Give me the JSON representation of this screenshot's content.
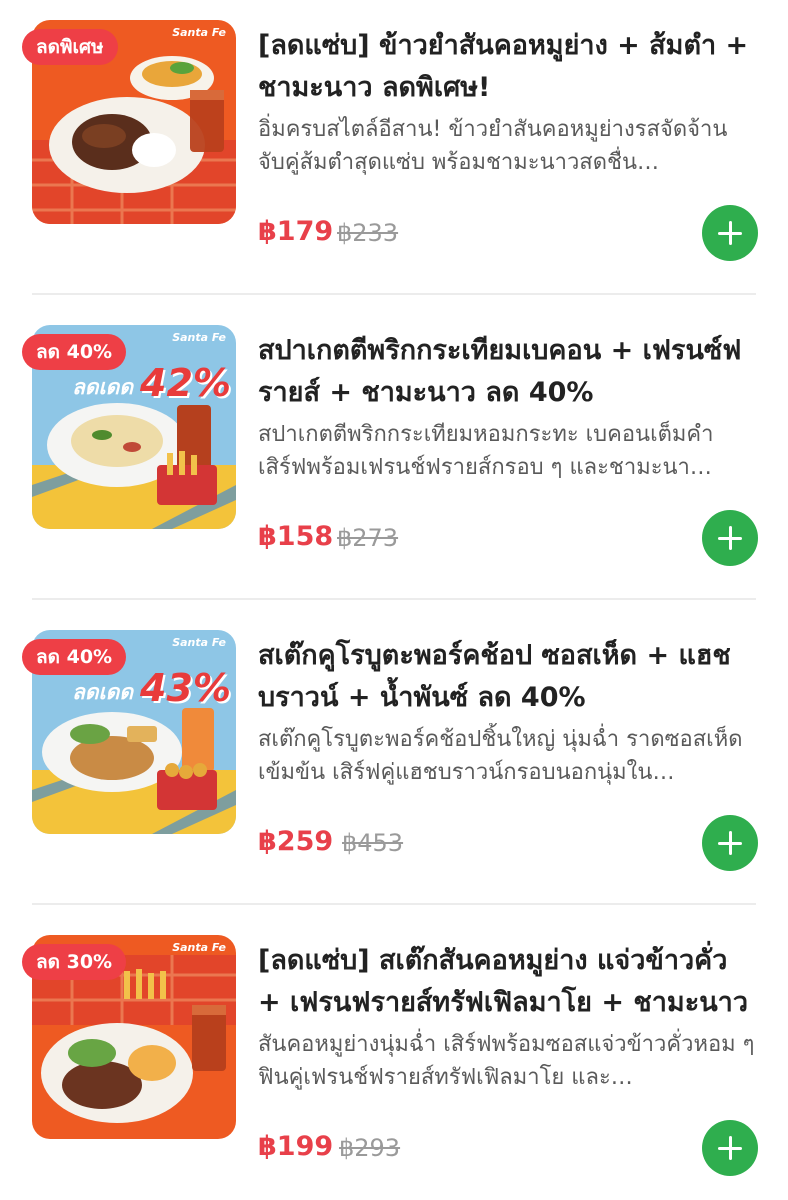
{
  "items": [
    {
      "badge": "ลดพิเศษ",
      "title": "[ลดแซ่บ] ข้าวยำสันคอหมูย่าง + ส้มตำ + ชามะนาว ลดพิเศษ!",
      "description": "อิ่มครบสไตล์อีสาน! ข้าวยำสันคอหมูย่างรสจัดจ้าน จับคู่ส้มตำสุดแซ่บ พร้อมชามะนาวสดชื่น…",
      "price": "฿179",
      "old_price": "฿233",
      "brand": "Santa Fe",
      "image": "pork-salad-rice-set"
    },
    {
      "badge": "ลด 40%",
      "title": "สปาเกตตีพริกกระเทียมเบคอน + เฟรนซ์ฟรายส์ + ชามะนาว ลด 40%",
      "description": "สปาเกตตีพริกกระเทียมหอมกระทะ เบคอนเต็มคำ เสิร์ฟพร้อมเฟรนช์ฟรายส์กรอบ ๆ และชามะนา…",
      "price": "฿158",
      "old_price": "฿273",
      "brand": "Santa Fe",
      "promo_text": "ลดเดด",
      "promo_percent": "42%",
      "image": "spaghetti-set"
    },
    {
      "badge": "ลด 40%",
      "title": "สเต๊กคูโรบูตะพอร์คช้อป ซอสเห็ด + แฮชบราวน์ + น้ำพันซ์ ลด 40%",
      "description": "สเต๊กคูโรบูตะพอร์คช้อปชิ้นใหญ่ นุ่มฉ่ำ ราดซอสเห็ดเข้มข้น เสิร์ฟคู่แฮชบราวน์กรอบนอกนุ่มใน…",
      "price": "฿259",
      "old_price": "฿453",
      "brand": "Santa Fe",
      "promo_text": "ลดเดด",
      "promo_percent": "43%",
      "image": "pork-chop-set"
    },
    {
      "badge": "ลด 30%",
      "title": "[ลดแซ่บ] สเต๊กสันคอหมูย่าง แจ่วข้าวคั่ว + เฟรนฟรายส์ทรัฟเฟิลมาโย + ชามะนาว",
      "description": "สันคอหมูย่างนุ่มฉ่ำ เสิร์ฟพร้อมซอสแจ่วข้าวคั่วหอม ๆ ฟินคู่เฟรนช์ฟรายส์ทรัฟเฟิลมาโย และ…",
      "price": "฿199",
      "old_price": "฿293",
      "brand": "Santa Fe",
      "image": "pork-steak-set"
    }
  ]
}
